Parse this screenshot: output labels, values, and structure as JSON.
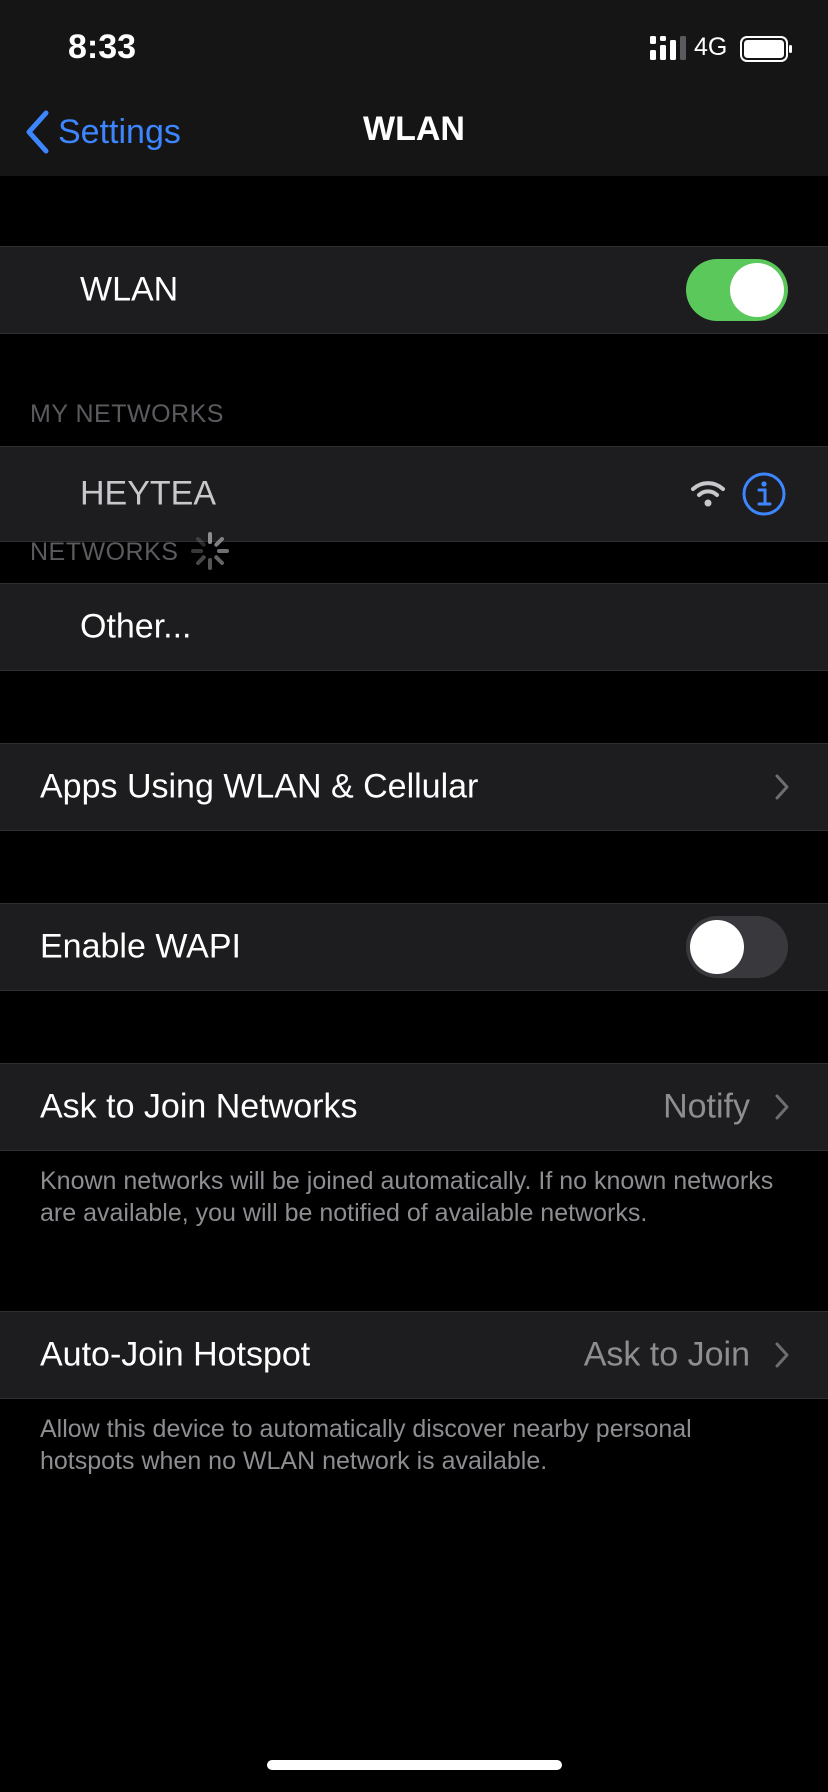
{
  "status_bar": {
    "time": "8:33",
    "network_type": "4G"
  },
  "nav": {
    "back_label": "Settings",
    "title": "WLAN"
  },
  "wlan_row": {
    "label": "WLAN",
    "toggle_on": true
  },
  "my_networks": {
    "header": "MY NETWORKS",
    "items": [
      {
        "name": "HEYTEA",
        "icons": [
          "wifi-icon",
          "info-icon"
        ]
      }
    ]
  },
  "networks": {
    "header": "NETWORKS",
    "other_label": "Other..."
  },
  "apps_row": {
    "label": "Apps Using WLAN & Cellular"
  },
  "wapi_row": {
    "label": "Enable WAPI",
    "toggle_on": false
  },
  "ask_join_row": {
    "label": "Ask to Join Networks",
    "value": "Notify",
    "footer": "Known networks will be joined automatically. If no known networks are available, you will be notified of available networks."
  },
  "hotspot_row": {
    "label": "Auto-Join Hotspot",
    "value": "Ask to Join",
    "footer": "Allow this device to automatically discover nearby personal hotspots when no WLAN network is available."
  },
  "colors": {
    "accent": "#3d86ff",
    "toggle_on": "#5ac85a",
    "background": "#000000",
    "row_background": "#1d1d1f"
  }
}
